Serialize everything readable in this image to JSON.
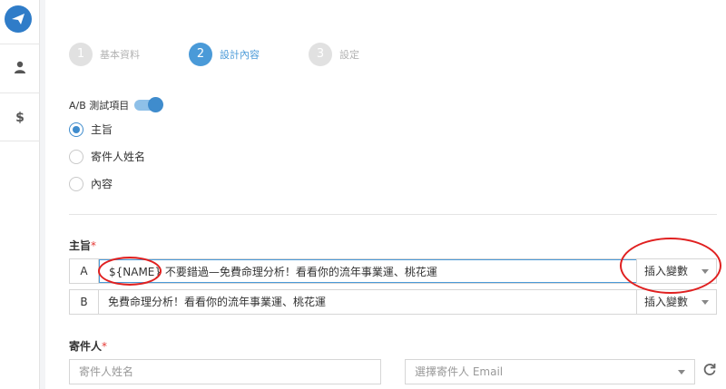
{
  "sidebar": {
    "items": [
      {
        "icon": "paper-plane-icon"
      },
      {
        "icon": "user-icon"
      },
      {
        "icon": "dollar-icon",
        "glyph": "$"
      }
    ]
  },
  "steps": [
    {
      "num": "1",
      "label": "基本資料",
      "active": false
    },
    {
      "num": "2",
      "label": "設計內容",
      "active": true
    },
    {
      "num": "3",
      "label": "設定",
      "active": false
    }
  ],
  "ab_test": {
    "label": "A/B 測試項目",
    "enabled": true
  },
  "options": [
    {
      "label": "主旨",
      "checked": true
    },
    {
      "label": "寄件人姓名",
      "checked": false
    },
    {
      "label": "內容",
      "checked": false
    }
  ],
  "subject": {
    "label": "主旨",
    "required_mark": "*",
    "rows": [
      {
        "letter": "A",
        "value": "${NAME} 不要錯過—免費命理分析！看看你的流年事業運、桃花運",
        "select": "插入變數"
      },
      {
        "letter": "B",
        "value": "免費命理分析！看看你的流年事業運、桃花運",
        "select": "插入變數"
      }
    ]
  },
  "sender": {
    "label": "寄件人",
    "required_mark": "*",
    "name_placeholder": "寄件人姓名",
    "email_placeholder": "選擇寄件人 Email"
  },
  "colors": {
    "accent": "#4a9ad8",
    "annotation": "#e02020"
  }
}
